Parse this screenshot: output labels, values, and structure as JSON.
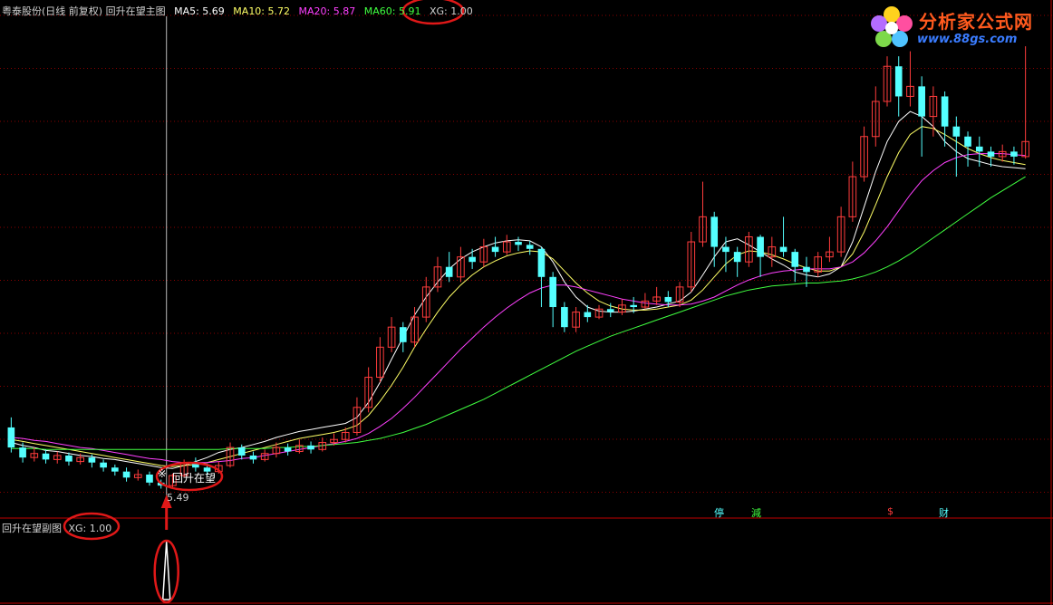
{
  "header": {
    "title": "粤泰股份(日线 前复权) 回升在望主图",
    "ma5": "MA5: 5.69",
    "ma10": "MA10: 5.72",
    "ma20": "MA20: 5.87",
    "ma60": "MA60: 5.91",
    "xg": "XG: 1.00"
  },
  "sub_header": {
    "title": "回升在望副图",
    "xg": "XG: 1.00"
  },
  "logo": {
    "main": "分析家公式网",
    "url": "www.88gs.com"
  },
  "markers": {
    "signal": "回升在望",
    "low_price": "5.49",
    "stop": "停",
    "reduce": "減",
    "dollar": "$",
    "wealth": "财"
  },
  "colors": {
    "up": "#ff3c3c",
    "down": "#54ffff",
    "ma5": "#ffffff",
    "ma10": "#ffff66",
    "ma20": "#ff40ff",
    "ma60": "#40ff40",
    "annotation": "#e01818"
  },
  "chart_data": {
    "type": "line",
    "title": "粤泰股份(日线 前复权) 回升在望主图",
    "series": [
      {
        "name": "MA5",
        "values": [
          5.95,
          5.92,
          5.9,
          5.87,
          5.86,
          5.84,
          5.82,
          5.81,
          5.79,
          5.78,
          5.76,
          5.74,
          5.72,
          5.7,
          5.69,
          5.72,
          5.76,
          5.8,
          5.85,
          5.88,
          5.9,
          5.93,
          5.96,
          6.0,
          6.03,
          6.06,
          6.08,
          6.1,
          6.12,
          6.14,
          6.2,
          6.35,
          6.55,
          6.78,
          7.0,
          7.22,
          7.4,
          7.55,
          7.68,
          7.78,
          7.85,
          7.9,
          7.94,
          7.96,
          7.97,
          7.96,
          7.9,
          7.75,
          7.55,
          7.4,
          7.3,
          7.26,
          7.25,
          7.25,
          7.26,
          7.28,
          7.3,
          7.33,
          7.36,
          7.45,
          7.62,
          7.8,
          7.95,
          7.98,
          7.92,
          7.85,
          7.78,
          7.72,
          7.65,
          7.62,
          7.6,
          7.63,
          7.7,
          7.95,
          8.3,
          8.65,
          8.95,
          9.15,
          9.25,
          9.2,
          9.1,
          8.95,
          8.85,
          8.78,
          8.75,
          8.72,
          8.7,
          8.69,
          8.68
        ]
      },
      {
        "name": "MA10",
        "values": [
          5.98,
          5.96,
          5.94,
          5.92,
          5.9,
          5.88,
          5.86,
          5.84,
          5.82,
          5.8,
          5.78,
          5.76,
          5.74,
          5.72,
          5.71,
          5.72,
          5.73,
          5.75,
          5.78,
          5.81,
          5.84,
          5.87,
          5.9,
          5.93,
          5.96,
          5.99,
          6.01,
          6.03,
          6.05,
          6.08,
          6.12,
          6.22,
          6.36,
          6.52,
          6.7,
          6.9,
          7.08,
          7.25,
          7.4,
          7.52,
          7.62,
          7.7,
          7.76,
          7.81,
          7.84,
          7.86,
          7.85,
          7.78,
          7.66,
          7.54,
          7.44,
          7.36,
          7.31,
          7.28,
          7.27,
          7.27,
          7.28,
          7.3,
          7.32,
          7.37,
          7.47,
          7.6,
          7.73,
          7.82,
          7.86,
          7.85,
          7.82,
          7.78,
          7.73,
          7.69,
          7.66,
          7.66,
          7.7,
          7.83,
          8.05,
          8.32,
          8.6,
          8.84,
          9.02,
          9.1,
          9.08,
          9.02,
          8.95,
          8.88,
          8.83,
          8.79,
          8.76,
          8.74,
          8.72
        ]
      },
      {
        "name": "MA20",
        "values": [
          6.0,
          5.99,
          5.97,
          5.96,
          5.94,
          5.92,
          5.9,
          5.89,
          5.87,
          5.85,
          5.83,
          5.81,
          5.79,
          5.78,
          5.76,
          5.75,
          5.75,
          5.75,
          5.76,
          5.77,
          5.79,
          5.8,
          5.82,
          5.84,
          5.86,
          5.88,
          5.9,
          5.92,
          5.94,
          5.96,
          5.99,
          6.04,
          6.11,
          6.19,
          6.29,
          6.4,
          6.52,
          6.64,
          6.76,
          6.88,
          6.99,
          7.1,
          7.2,
          7.29,
          7.37,
          7.44,
          7.49,
          7.52,
          7.52,
          7.5,
          7.47,
          7.44,
          7.41,
          7.38,
          7.36,
          7.34,
          7.33,
          7.32,
          7.32,
          7.33,
          7.36,
          7.4,
          7.46,
          7.52,
          7.57,
          7.61,
          7.64,
          7.66,
          7.67,
          7.68,
          7.68,
          7.68,
          7.7,
          7.75,
          7.84,
          7.96,
          8.1,
          8.26,
          8.42,
          8.56,
          8.66,
          8.74,
          8.79,
          8.82,
          8.83,
          8.83,
          8.83,
          8.82,
          8.81
        ]
      },
      {
        "name": "MA60",
        "values": [
          5.89,
          5.89,
          5.89,
          5.88,
          5.88,
          5.88,
          5.88,
          5.88,
          5.88,
          5.88,
          5.88,
          5.88,
          5.88,
          5.88,
          5.88,
          5.88,
          5.88,
          5.88,
          5.88,
          5.89,
          5.89,
          5.89,
          5.89,
          5.9,
          5.9,
          5.91,
          5.91,
          5.92,
          5.93,
          5.94,
          5.95,
          5.97,
          5.99,
          6.02,
          6.05,
          6.09,
          6.13,
          6.18,
          6.23,
          6.28,
          6.33,
          6.38,
          6.44,
          6.5,
          6.56,
          6.62,
          6.68,
          6.74,
          6.8,
          6.86,
          6.91,
          6.96,
          7.01,
          7.05,
          7.09,
          7.13,
          7.17,
          7.21,
          7.25,
          7.29,
          7.33,
          7.37,
          7.41,
          7.44,
          7.47,
          7.49,
          7.51,
          7.52,
          7.53,
          7.54,
          7.54,
          7.55,
          7.56,
          7.58,
          7.61,
          7.65,
          7.7,
          7.76,
          7.83,
          7.91,
          7.99,
          8.07,
          8.15,
          8.23,
          8.31,
          8.39,
          8.46,
          8.53,
          8.6
        ]
      }
    ],
    "candles": [
      [
        6.1,
        5.9,
        6.2,
        5.85
      ],
      [
        5.9,
        5.8,
        5.95,
        5.75
      ],
      [
        5.8,
        5.84,
        5.9,
        5.76
      ],
      [
        5.84,
        5.78,
        5.88,
        5.74
      ],
      [
        5.78,
        5.82,
        5.86,
        5.74
      ],
      [
        5.82,
        5.76,
        5.85,
        5.72
      ],
      [
        5.76,
        5.8,
        5.84,
        5.73
      ],
      [
        5.8,
        5.75,
        5.83,
        5.7
      ],
      [
        5.75,
        5.7,
        5.78,
        5.66
      ],
      [
        5.7,
        5.66,
        5.73,
        5.62
      ],
      [
        5.66,
        5.6,
        5.7,
        5.56
      ],
      [
        5.6,
        5.63,
        5.68,
        5.57
      ],
      [
        5.63,
        5.55,
        5.66,
        5.52
      ],
      [
        5.55,
        5.52,
        5.58,
        5.49
      ],
      [
        5.52,
        5.62,
        5.64,
        5.5
      ],
      [
        5.62,
        5.75,
        5.78,
        5.6
      ],
      [
        5.75,
        5.7,
        5.8,
        5.66
      ],
      [
        5.7,
        5.66,
        5.74,
        5.62
      ],
      [
        5.66,
        5.72,
        5.76,
        5.64
      ],
      [
        5.72,
        5.9,
        5.95,
        5.7
      ],
      [
        5.9,
        5.82,
        5.93,
        5.78
      ],
      [
        5.82,
        5.78,
        5.86,
        5.74
      ],
      [
        5.78,
        5.84,
        5.88,
        5.76
      ],
      [
        5.84,
        5.9,
        5.95,
        5.8
      ],
      [
        5.9,
        5.86,
        5.94,
        5.82
      ],
      [
        5.86,
        5.92,
        5.98,
        5.84
      ],
      [
        5.92,
        5.88,
        5.96,
        5.84
      ],
      [
        5.88,
        5.95,
        6.0,
        5.86
      ],
      [
        5.95,
        5.98,
        6.04,
        5.92
      ],
      [
        5.98,
        6.05,
        6.1,
        5.95
      ],
      [
        6.05,
        6.3,
        6.4,
        6.02
      ],
      [
        6.3,
        6.6,
        6.7,
        6.25
      ],
      [
        6.6,
        6.9,
        7.0,
        6.55
      ],
      [
        6.9,
        7.1,
        7.2,
        6.85
      ],
      [
        7.1,
        6.95,
        7.15,
        6.85
      ],
      [
        6.95,
        7.2,
        7.3,
        6.9
      ],
      [
        7.2,
        7.5,
        7.6,
        7.15
      ],
      [
        7.5,
        7.7,
        7.8,
        7.45
      ],
      [
        7.7,
        7.6,
        7.85,
        7.55
      ],
      [
        7.6,
        7.8,
        7.9,
        7.55
      ],
      [
        7.8,
        7.75,
        7.88,
        7.68
      ],
      [
        7.75,
        7.9,
        7.98,
        7.7
      ],
      [
        7.9,
        7.85,
        8.0,
        7.8
      ],
      [
        7.85,
        7.95,
        8.02,
        7.82
      ],
      [
        7.95,
        7.92,
        8.0,
        7.86
      ],
      [
        7.92,
        7.88,
        7.96,
        7.82
      ],
      [
        7.88,
        7.6,
        7.9,
        7.3
      ],
      [
        7.6,
        7.3,
        7.65,
        7.1
      ],
      [
        7.3,
        7.1,
        7.35,
        7.05
      ],
      [
        7.1,
        7.25,
        7.3,
        7.05
      ],
      [
        7.25,
        7.2,
        7.32,
        7.15
      ],
      [
        7.2,
        7.28,
        7.32,
        7.18
      ],
      [
        7.28,
        7.25,
        7.34,
        7.2
      ],
      [
        7.25,
        7.32,
        7.38,
        7.22
      ],
      [
        7.32,
        7.3,
        7.4,
        7.24
      ],
      [
        7.3,
        7.36,
        7.44,
        7.28
      ],
      [
        7.36,
        7.4,
        7.5,
        7.32
      ],
      [
        7.4,
        7.35,
        7.46,
        7.3
      ],
      [
        7.35,
        7.5,
        7.55,
        7.3
      ],
      [
        7.5,
        7.95,
        8.05,
        7.45
      ],
      [
        7.95,
        8.2,
        8.55,
        7.9
      ],
      [
        8.2,
        7.9,
        8.25,
        7.7
      ],
      [
        7.9,
        7.85,
        8.0,
        7.65
      ],
      [
        7.85,
        7.75,
        7.9,
        7.6
      ],
      [
        7.75,
        8.0,
        8.05,
        7.7
      ],
      [
        8.0,
        7.8,
        8.02,
        7.6
      ],
      [
        7.8,
        7.9,
        8.0,
        7.7
      ],
      [
        7.9,
        7.85,
        8.2,
        7.8
      ],
      [
        7.85,
        7.7,
        7.88,
        7.55
      ],
      [
        7.7,
        7.65,
        7.8,
        7.5
      ],
      [
        7.65,
        7.8,
        7.85,
        7.6
      ],
      [
        7.8,
        7.85,
        8.0,
        7.75
      ],
      [
        7.85,
        8.2,
        8.3,
        7.8
      ],
      [
        8.2,
        8.6,
        8.75,
        8.15
      ],
      [
        8.6,
        9.0,
        9.1,
        8.55
      ],
      [
        9.0,
        9.35,
        9.5,
        8.9
      ],
      [
        9.35,
        9.7,
        9.8,
        9.3
      ],
      [
        9.7,
        9.4,
        9.8,
        9.2
      ],
      [
        9.4,
        9.5,
        9.85,
        9.3
      ],
      [
        9.5,
        9.2,
        9.6,
        8.8
      ],
      [
        9.2,
        9.4,
        9.5,
        9.0
      ],
      [
        9.4,
        9.1,
        9.45,
        8.9
      ],
      [
        9.1,
        9.0,
        9.2,
        8.6
      ],
      [
        9.0,
        8.9,
        9.05,
        8.7
      ],
      [
        8.9,
        8.85,
        9.0,
        8.7
      ],
      [
        8.85,
        8.8,
        8.9,
        8.7
      ],
      [
        8.8,
        8.85,
        8.92,
        8.75
      ],
      [
        8.85,
        8.8,
        8.9,
        8.72
      ],
      [
        8.8,
        8.95,
        9.9,
        8.78
      ]
    ],
    "candle_format": [
      "open",
      "close",
      "high",
      "low"
    ],
    "signal_index": 13,
    "low_value": 5.49,
    "ylim": [
      5.35,
      10.0
    ],
    "sub_chart": {
      "name": "XG",
      "value": 1.0,
      "signal_index": 13
    }
  }
}
